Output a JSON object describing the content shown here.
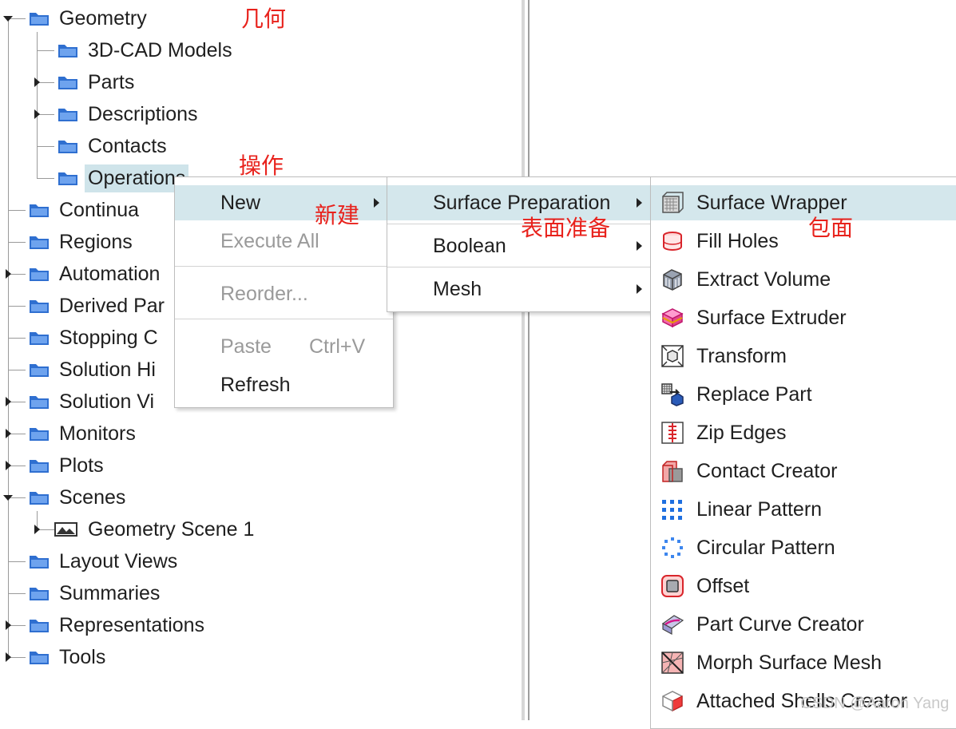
{
  "tree": {
    "geometry": "Geometry",
    "geometry_children": [
      "3D-CAD Models",
      "Parts",
      "Descriptions",
      "Contacts",
      "Operations"
    ],
    "continua": "Continua",
    "regions": "Regions",
    "automation": "Automation",
    "derived_parts": "Derived Par",
    "stopping_criteria": "Stopping C",
    "solution_histories": "Solution Hi",
    "solution_views": "Solution Vi",
    "monitors": "Monitors",
    "plots": "Plots",
    "scenes": "Scenes",
    "geometry_scene": "Geometry Scene 1",
    "layout_views": "Layout Views",
    "summaries": "Summaries",
    "representations": "Representations",
    "tools": "Tools"
  },
  "context_menu": {
    "new": "New",
    "execute_all": "Execute All",
    "reorder": "Reorder...",
    "paste": "Paste",
    "paste_shortcut": "Ctrl+V",
    "refresh": "Refresh"
  },
  "new_submenu": {
    "surface_preparation": "Surface Preparation",
    "boolean": "Boolean",
    "mesh": "Mesh"
  },
  "surface_prep_submenu": {
    "items": [
      {
        "label": "Surface Wrapper",
        "icon": "surface-wrapper-icon"
      },
      {
        "label": "Fill Holes",
        "icon": "fill-holes-icon"
      },
      {
        "label": "Extract Volume",
        "icon": "extract-volume-icon"
      },
      {
        "label": "Surface Extruder",
        "icon": "surface-extruder-icon"
      },
      {
        "label": "Transform",
        "icon": "transform-icon"
      },
      {
        "label": "Replace Part",
        "icon": "replace-part-icon"
      },
      {
        "label": "Zip Edges",
        "icon": "zip-edges-icon"
      },
      {
        "label": "Contact Creator",
        "icon": "contact-creator-icon"
      },
      {
        "label": "Linear Pattern",
        "icon": "linear-pattern-icon"
      },
      {
        "label": "Circular Pattern",
        "icon": "circular-pattern-icon"
      },
      {
        "label": "Offset",
        "icon": "offset-icon"
      },
      {
        "label": "Part Curve Creator",
        "icon": "part-curve-creator-icon"
      },
      {
        "label": "Morph Surface Mesh",
        "icon": "morph-surface-mesh-icon"
      },
      {
        "label": "Attached Shells Creator",
        "icon": "attached-shells-creator-icon"
      }
    ]
  },
  "annotations": {
    "geometry": "几何",
    "operations": "操作",
    "new": "新建",
    "surface_preparation": "表面准备",
    "surface_wrapper": "包面"
  },
  "watermark": "CSDN @Aaron Yang",
  "colors": {
    "folder_blue": "#2f6fd0",
    "highlight": "#d4e7ec",
    "annotation_red": "#e8221c"
  }
}
